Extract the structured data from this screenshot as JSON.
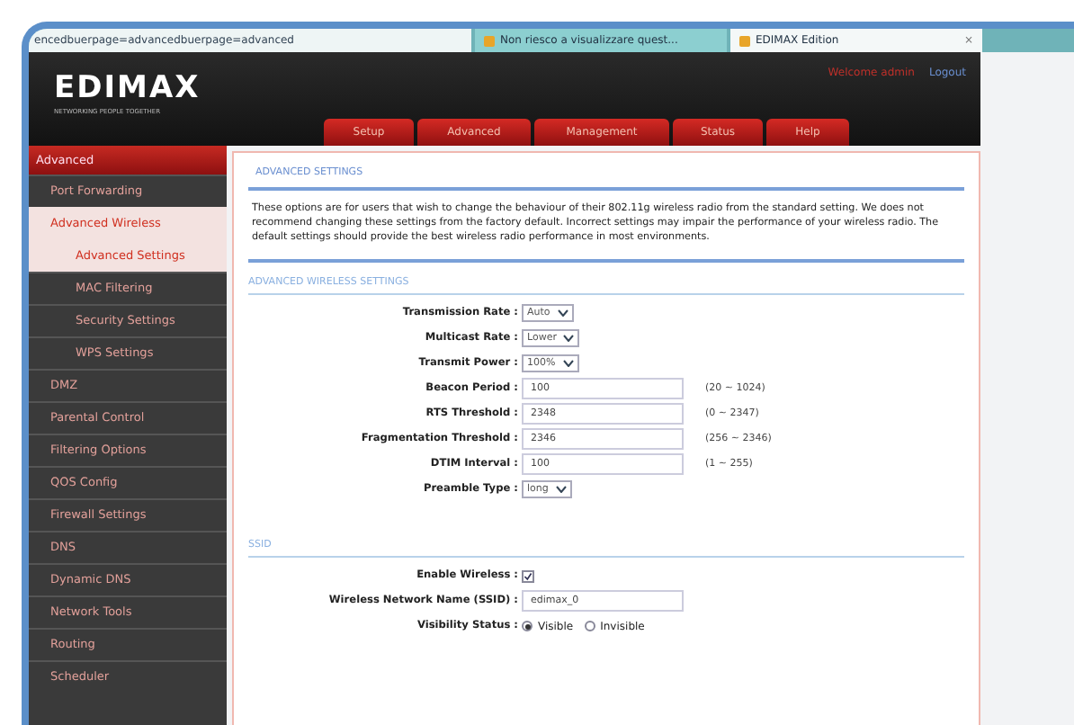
{
  "browser": {
    "address": "encedbuerpage=advancedbuerpage=advanced",
    "tabs": [
      {
        "label": "Non riesco a visualizzare quest...",
        "selected": false
      },
      {
        "label": "EDIMAX Edition",
        "selected": true,
        "close": "×"
      }
    ]
  },
  "header": {
    "logo": "EDIMAX",
    "tagline": "NETWORKING PEOPLE TOGETHER",
    "welcome": "Welcome admin",
    "logout": "Logout",
    "tabs": [
      {
        "label": "Setup",
        "selected": false
      },
      {
        "label": "Advanced",
        "selected": false
      },
      {
        "label": "Management",
        "selected": false
      },
      {
        "label": "Status",
        "selected": false
      },
      {
        "label": "Help",
        "selected": false
      }
    ]
  },
  "sidebar": {
    "title": "Advanced",
    "items": [
      {
        "label": "Port Forwarding",
        "selected": false
      },
      {
        "label": "Advanced Wireless",
        "selected": true,
        "children": [
          {
            "label": "Advanced Settings",
            "selected": true
          },
          {
            "label": "MAC Filtering",
            "selected": false
          },
          {
            "label": "Security Settings",
            "selected": false
          },
          {
            "label": "WPS Settings",
            "selected": false
          }
        ]
      },
      {
        "label": "DMZ",
        "selected": false
      },
      {
        "label": "Parental Control",
        "selected": false
      },
      {
        "label": "Filtering Options",
        "selected": false
      },
      {
        "label": "QOS Config",
        "selected": false
      },
      {
        "label": "Firewall Settings",
        "selected": false
      },
      {
        "label": "DNS",
        "selected": false
      },
      {
        "label": "Dynamic DNS",
        "selected": false
      },
      {
        "label": "Network Tools",
        "selected": false
      },
      {
        "label": "Routing",
        "selected": false
      },
      {
        "label": "Scheduler",
        "selected": false
      }
    ]
  },
  "content": {
    "title": "ADVANCED SETTINGS",
    "description": "These options are for users that wish to change the behaviour of their 802.11g wireless radio from the standard setting. We does not recommend changing these settings from the factory default. Incorrect settings may impair the performance of your wireless radio. The default settings should provide the best wireless radio performance in most environments.",
    "sections": [
      {
        "title": "ADVANCED WIRELESS SETTINGS",
        "rows": [
          {
            "kind": "select",
            "label": "Transmission Rate :",
            "value": "Auto"
          },
          {
            "kind": "select",
            "label": "Multicast Rate :",
            "value": "Lower"
          },
          {
            "kind": "select",
            "label": "Transmit Power :",
            "value": "100%"
          },
          {
            "kind": "text",
            "label": "Beacon Period :",
            "value": "100",
            "hint": "(20 ~ 1024)"
          },
          {
            "kind": "text",
            "label": "RTS Threshold :",
            "value": "2348",
            "hint": "(0 ~ 2347)"
          },
          {
            "kind": "text",
            "label": "Fragmentation Threshold :",
            "value": "2346",
            "hint": "(256 ~ 2346)"
          },
          {
            "kind": "text",
            "label": "DTIM Interval :",
            "value": "100",
            "hint": "(1 ~ 255)"
          },
          {
            "kind": "select",
            "label": "Preamble Type :",
            "value": "long"
          }
        ]
      },
      {
        "title": "SSID",
        "rows": [
          {
            "kind": "checkbox",
            "label": "Enable Wireless :",
            "checked": true
          },
          {
            "kind": "text",
            "label": "Wireless Network Name (SSID) :",
            "value": "edimax_0"
          },
          {
            "kind": "radio",
            "label": "Visibility Status :",
            "options": [
              {
                "label": "Visible",
                "selected": true
              },
              {
                "label": "Invisible",
                "selected": false
              }
            ]
          }
        ]
      }
    ]
  }
}
